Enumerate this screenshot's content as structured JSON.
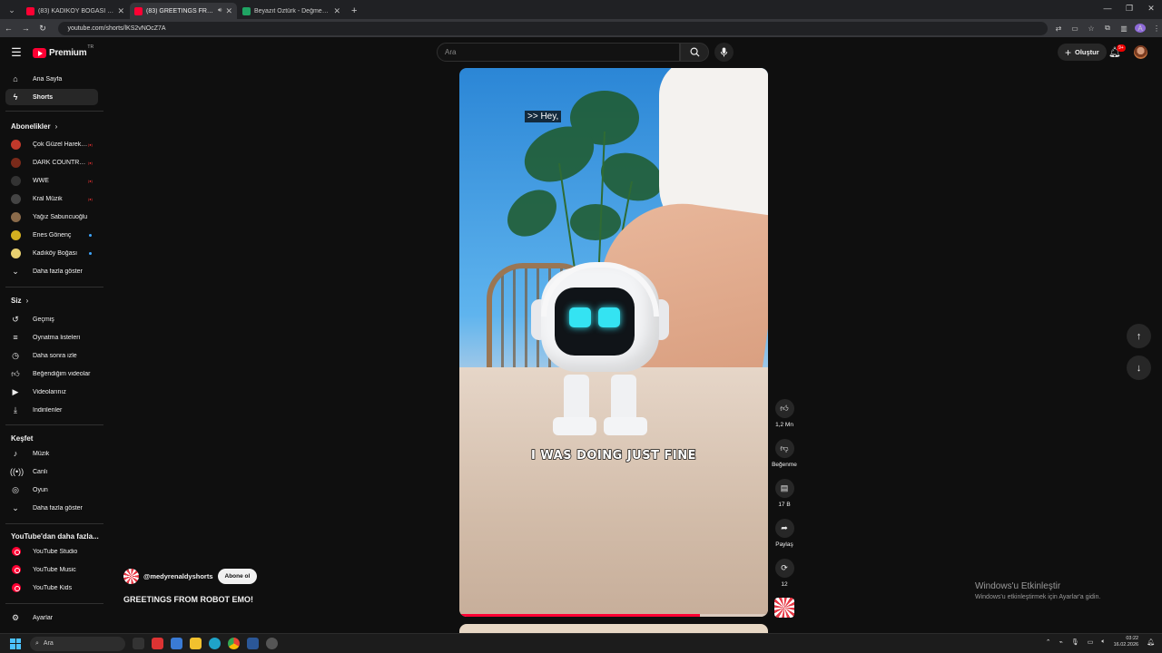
{
  "browser": {
    "tabs": [
      {
        "title": "(83) KADIKÖY BOĞASI EGE TUR",
        "favicon": "youtube-icon",
        "active": false
      },
      {
        "title": "(83) GREETINGS FROM ROB",
        "favicon": "youtube-icon",
        "active": true
      },
      {
        "title": "Beyazıt Öztürk - Değmen Benim",
        "favicon": "sheet-icon",
        "active": false
      }
    ],
    "url": "youtube.com/shorts/lKS2vNOcZ7A",
    "profile_initial": "A"
  },
  "header": {
    "logo_text": "Premium",
    "logo_sup": "TR",
    "search_placeholder": "Ara",
    "create_label": "Oluştur",
    "notifications_badge": "9+"
  },
  "sidebar": {
    "main": [
      {
        "label": "Ana Sayfa",
        "icon": "home-icon",
        "active": false
      },
      {
        "label": "Shorts",
        "icon": "shorts-icon",
        "active": true
      }
    ],
    "subscriptions_heading": "Abonelikler",
    "subscriptions": [
      {
        "label": "Çok Güzel Hareket...",
        "indicator": "live",
        "color": "#c0392b"
      },
      {
        "label": "DARK COUNTRY ...",
        "indicator": "live",
        "color": "#7a2a1a"
      },
      {
        "label": "WWE",
        "indicator": "live",
        "color": "#333333"
      },
      {
        "label": "Kral Müzik",
        "indicator": "live",
        "color": "#444444"
      },
      {
        "label": "Yağız Sabuncuoğlu",
        "indicator": "none",
        "color": "#8a6a4a"
      },
      {
        "label": "Enes Gönenç",
        "indicator": "dot",
        "color": "#d4b020"
      },
      {
        "label": "Kadıköy Boğası",
        "indicator": "dot",
        "color": "#e8d070"
      }
    ],
    "subs_more": "Daha fazla göster",
    "you_heading": "Siz",
    "you": [
      {
        "label": "Geçmiş",
        "icon": "history-icon"
      },
      {
        "label": "Oynatma listeleri",
        "icon": "playlist-icon"
      },
      {
        "label": "Daha sonra izle",
        "icon": "clock-icon"
      },
      {
        "label": "Beğendiğim videolar",
        "icon": "thumbs-up-icon"
      },
      {
        "label": "Videolarınız",
        "icon": "video-icon"
      },
      {
        "label": "İndirilenler",
        "icon": "download-icon"
      }
    ],
    "explore_heading": "Keşfet",
    "explore": [
      {
        "label": "Müzik",
        "icon": "music-icon"
      },
      {
        "label": "Canlı",
        "icon": "live-icon"
      },
      {
        "label": "Oyun",
        "icon": "gaming-icon"
      },
      {
        "label": "Daha fazla göster",
        "icon": "chevron-down-icon"
      }
    ],
    "more_heading": "YouTube'dan daha fazla...",
    "more": [
      {
        "label": "YouTube Studio"
      },
      {
        "label": "YouTube Music"
      },
      {
        "label": "YouTube Kids"
      }
    ],
    "settings_label": "Ayarlar"
  },
  "short": {
    "caption_top": ">> Hey,",
    "caption_main": "I WAS DOING JUST FINE",
    "progress": 0.78,
    "channel": "@medyrenaldyshorts",
    "subscribe_label": "Abone ol",
    "title": "GREETINGS FROM ROBOT EMO!"
  },
  "actions": {
    "likes": "1,2 Mn",
    "dislike_label": "Beğenme",
    "comments": "17 B",
    "share_label": "Paylaş",
    "remix_count": "12"
  },
  "watermark": {
    "line1": "Windows'u Etkinleştir",
    "line2": "Windows'u etkinleştirmek için Ayarlar'a gidin."
  },
  "taskbar": {
    "search_placeholder": "Ara",
    "time": "03:22",
    "date": "16.02.2026"
  }
}
